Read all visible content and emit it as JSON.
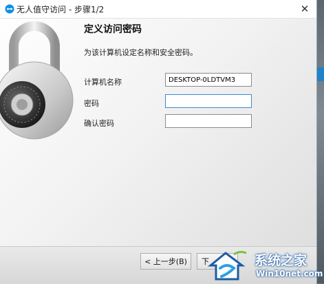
{
  "window": {
    "title": "无人值守访问 - 步骤1/2",
    "close_label": "✕"
  },
  "page": {
    "heading": "定义访问密码",
    "subtitle": "为该计算机设定名称和安全密码。"
  },
  "form": {
    "computer_name_label": "计算机名称",
    "computer_name_value": "DESKTOP-0LDTVM3",
    "password_label": "密码",
    "password_value": "",
    "confirm_label": "确认密码",
    "confirm_value": ""
  },
  "buttons": {
    "back_label": "< 上一步(B)",
    "next_label": "下"
  },
  "watermark": {
    "brand": "系统之家",
    "url": "Win10net.com"
  },
  "icons": [
    "teamviewer-icon",
    "padlock-icon",
    "close-icon",
    "house-logo-icon"
  ],
  "colors": {
    "focus_border": "#3b86d4",
    "watermark_blue": "#1b5da5"
  }
}
